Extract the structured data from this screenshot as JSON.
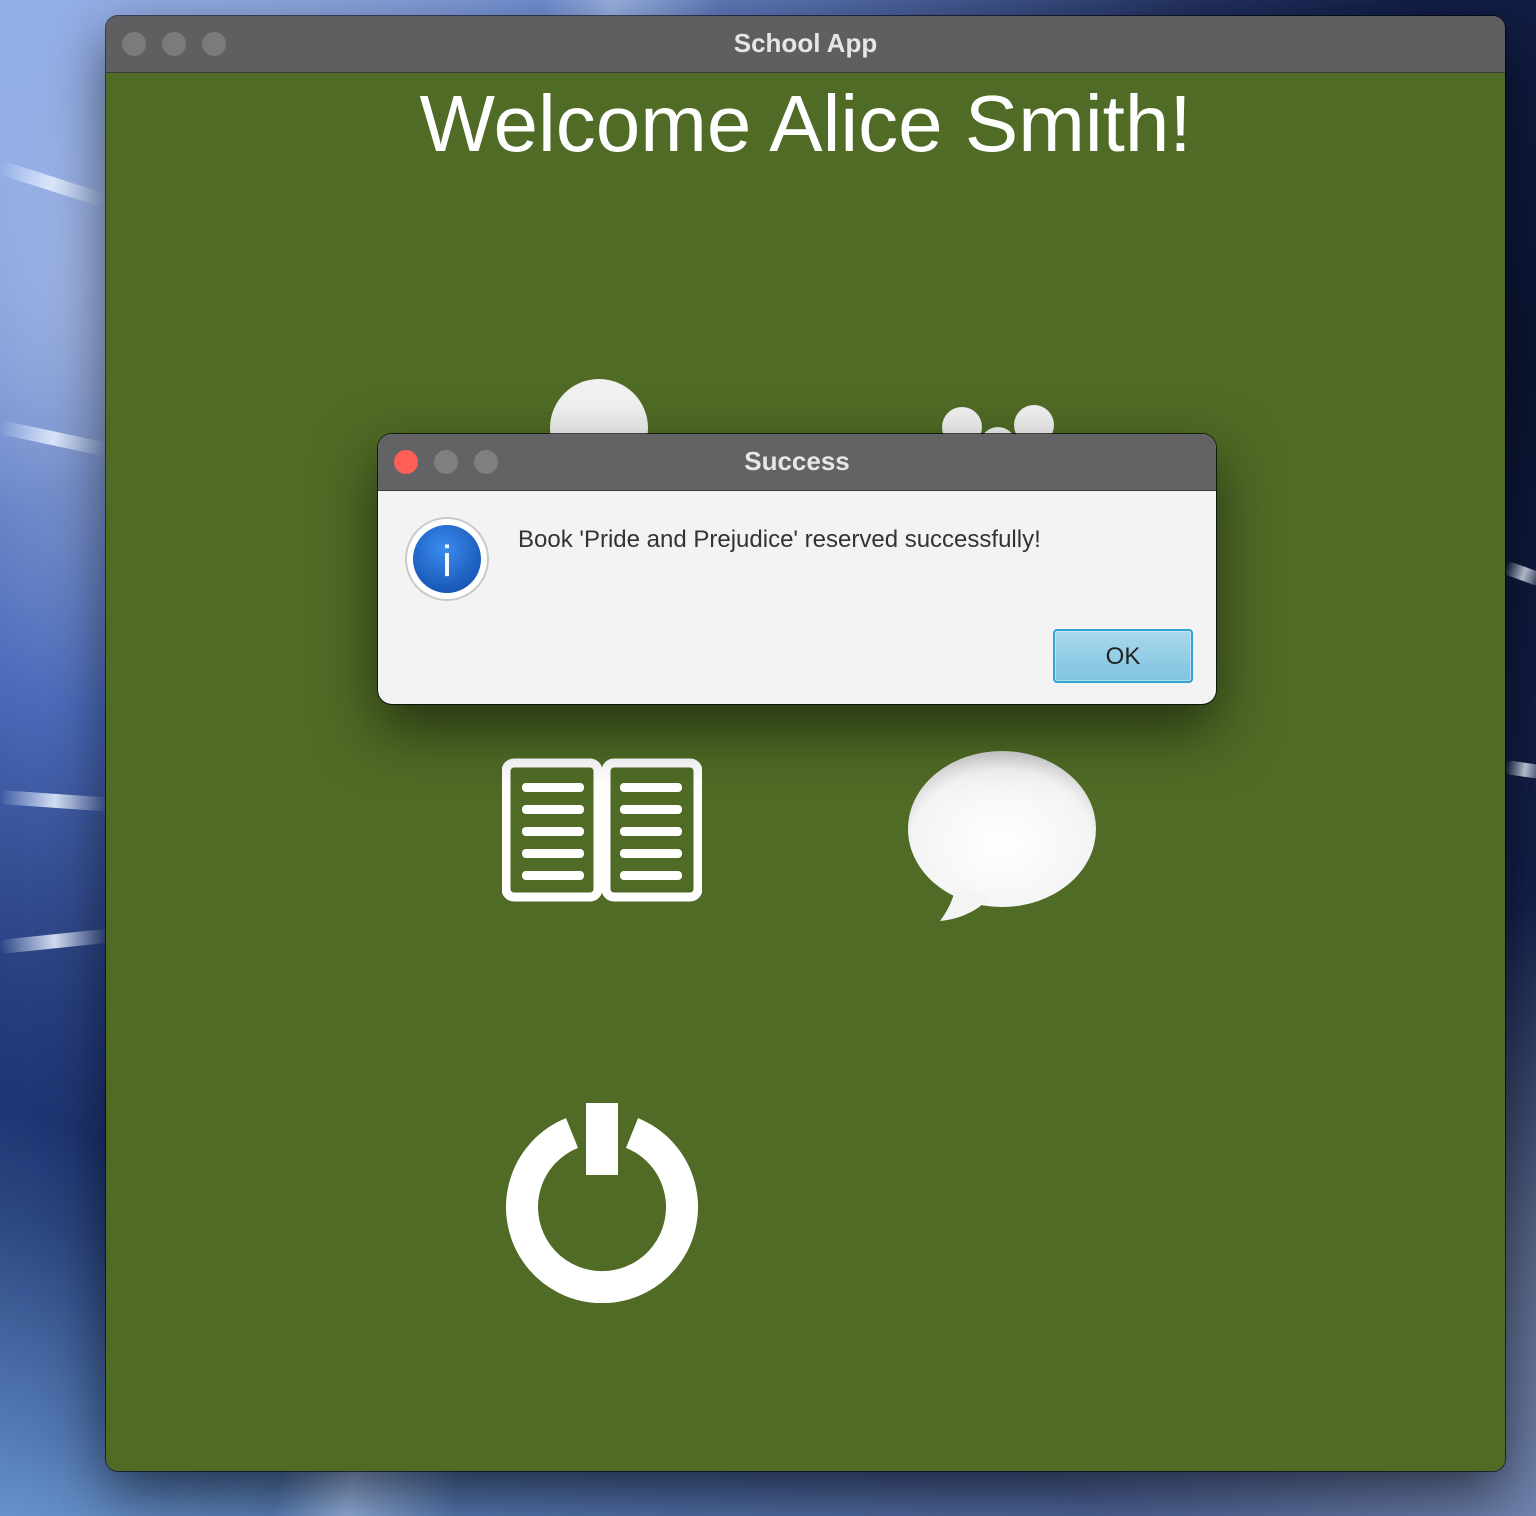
{
  "window": {
    "title": "School App"
  },
  "main": {
    "welcome_text": "Welcome Alice Smith!",
    "menu_icons": [
      "profile-icon",
      "group-icon",
      "book-icon",
      "chat-bubble-icon",
      "power-icon"
    ]
  },
  "dialog": {
    "title": "Success",
    "message": "Book 'Pride and Prejudice' reserved successfully!",
    "ok_label": "OK",
    "icon": "info-icon"
  },
  "colors": {
    "window_background": "#4f6b25",
    "titlebar": "#5f5f61",
    "close_button": "#fe5f57",
    "info_icon": "#1f6fd1",
    "ok_button": "#8fcde6"
  }
}
